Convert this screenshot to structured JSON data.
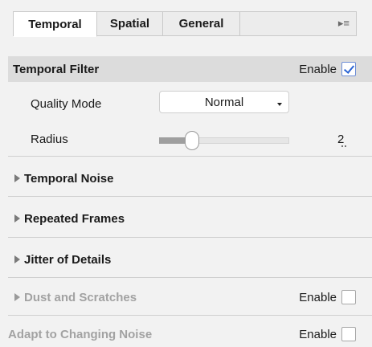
{
  "tabs": [
    {
      "label": "Temporal",
      "active": true
    },
    {
      "label": "Spatial",
      "active": false
    },
    {
      "label": "General",
      "active": false
    }
  ],
  "panel_menu_glyph": "▸≡",
  "temporal_filter": {
    "title": "Temporal Filter",
    "enable_label": "Enable",
    "enabled": true,
    "quality_mode": {
      "label": "Quality Mode",
      "value": "Normal"
    },
    "radius": {
      "label": "Radius",
      "value": "2",
      "slider_fraction": 0.25
    }
  },
  "sections": [
    {
      "title": "Temporal Noise",
      "dimmed": false
    },
    {
      "title": "Repeated Frames",
      "dimmed": false
    },
    {
      "title": "Jitter of Details",
      "dimmed": false
    },
    {
      "title": "Dust and Scratches",
      "dimmed": true,
      "enable_label": "Enable",
      "enabled": false
    }
  ],
  "adapt": {
    "title": "Adapt to Changing Noise",
    "enable_label": "Enable",
    "enabled": false
  },
  "colors": {
    "accent": "#2a64d4",
    "section_header_bg": "#dcdcdc",
    "dimmed_text": "#a2a2a2"
  }
}
